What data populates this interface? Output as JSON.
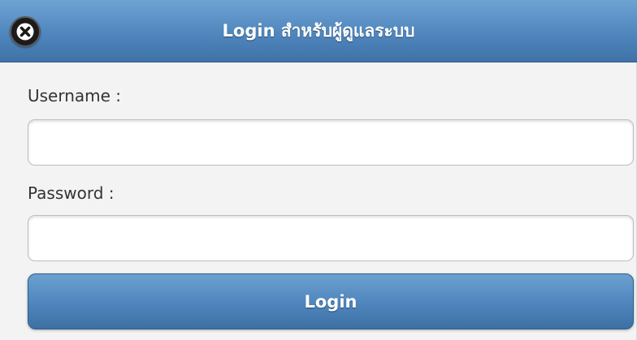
{
  "header": {
    "title": "Login สำหรับผู้ดูแลระบบ",
    "close_icon": "close-x-icon"
  },
  "form": {
    "username_label": "Username :",
    "username_value": "",
    "password_label": "Password :",
    "password_value": "",
    "submit_label": "Login"
  },
  "colors": {
    "accent": "#4f86bd",
    "background": "#f3f3f3"
  }
}
